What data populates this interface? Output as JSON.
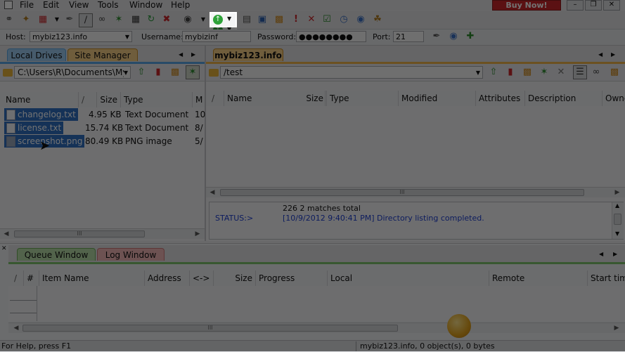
{
  "menu": {
    "file": "File",
    "edit": "Edit",
    "view": "View",
    "tools": "Tools",
    "window": "Window",
    "help": "Help",
    "buy_now": "Buy Now!"
  },
  "connection": {
    "host_label": "Host:",
    "host_value": "mybiz123.info",
    "username_label": "Username:",
    "username_value": "mybizinf",
    "password_label": "Password:",
    "password_value": "●●●●●●●●",
    "port_label": "Port:",
    "port_value": "21"
  },
  "left_panel": {
    "tabs": [
      "Local Drives",
      "Site Manager"
    ],
    "path": "C:\\Users\\R\\Documents\\My",
    "columns": [
      "Name",
      "/",
      "Size",
      "Type",
      "M"
    ],
    "files": [
      {
        "name": "changelog.txt",
        "size": "4.95 KB",
        "type": "Text Document",
        "mod": "10"
      },
      {
        "name": "license.txt",
        "size": "15.74 KB",
        "type": "Text Document",
        "mod": "8/"
      },
      {
        "name": "screenshot.png",
        "size": "80.49 KB",
        "type": "PNG image",
        "mod": "5/"
      }
    ],
    "scroll_grip": "III"
  },
  "right_panel": {
    "tab": "mybiz123.info",
    "path": "/test",
    "columns": [
      "/",
      "Name",
      "Size",
      "Type",
      "Modified",
      "Attributes",
      "Description",
      "Owne"
    ],
    "scroll_grip": "III",
    "log": {
      "line1": "226 2 matches total",
      "status_label": "STATUS:>",
      "status_msg": "[10/9/2012 9:40:41 PM] Directory listing completed."
    }
  },
  "queue": {
    "tabs": [
      "Queue Window",
      "Log Window"
    ],
    "columns": [
      "/",
      "#",
      "Item Name",
      "Address",
      "<->",
      "Size",
      "Progress",
      "Local",
      "Remote",
      "Start tim"
    ],
    "scroll_grip": "III"
  },
  "statusbar": {
    "help": "For Help, press F1",
    "info": "mybiz123.info, 0 object(s), 0 bytes"
  },
  "colors": {
    "accent_tab_local": "#5aa7e6",
    "accent_tab_site": "#f0b34a",
    "accent_tab_queue": "#7cc36a",
    "accent_tab_log": "#e98a8a",
    "selection": "#2f6fc1",
    "status_blue": "#1d3fd1"
  }
}
